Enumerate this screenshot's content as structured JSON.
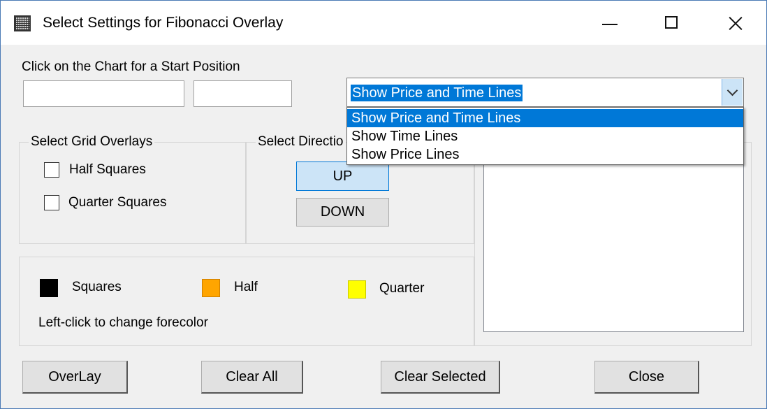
{
  "window": {
    "title": "Select Settings for Fibonacci Overlay",
    "icon": "grid-window-icon"
  },
  "start_position": {
    "label": "Click on the Chart for a Start Position",
    "x_value": "",
    "y_value": ""
  },
  "line_mode": {
    "selected": "Show Price and Time Lines",
    "options": [
      "Show Price and Time Lines",
      "Show Time Lines",
      "Show Price Lines"
    ],
    "expanded": true
  },
  "grid_overlays": {
    "title": "Select Grid Overlays",
    "half_squares": {
      "label": "Half Squares",
      "checked": false
    },
    "quarter_squares": {
      "label": "Quarter Squares",
      "checked": false
    }
  },
  "direction": {
    "title": "Select Directio",
    "up_label": "UP",
    "down_label": "DOWN",
    "selected": "UP"
  },
  "colors": {
    "squares": {
      "label": "Squares",
      "color": "#000000"
    },
    "half": {
      "label": "Half",
      "color": "#ffa500"
    },
    "quarter": {
      "label": "Quarter",
      "color": "#ffff00"
    },
    "hint": "Left-click to change forecolor"
  },
  "actions": {
    "overlay": "OverLay",
    "clear_all": "Clear All",
    "clear_selected": "Clear Selected",
    "close": "Close"
  },
  "theme": {
    "accent": "#0078d7",
    "selected_button_bg": "#cce4f7",
    "dialog_bg": "#f0f0f0"
  }
}
